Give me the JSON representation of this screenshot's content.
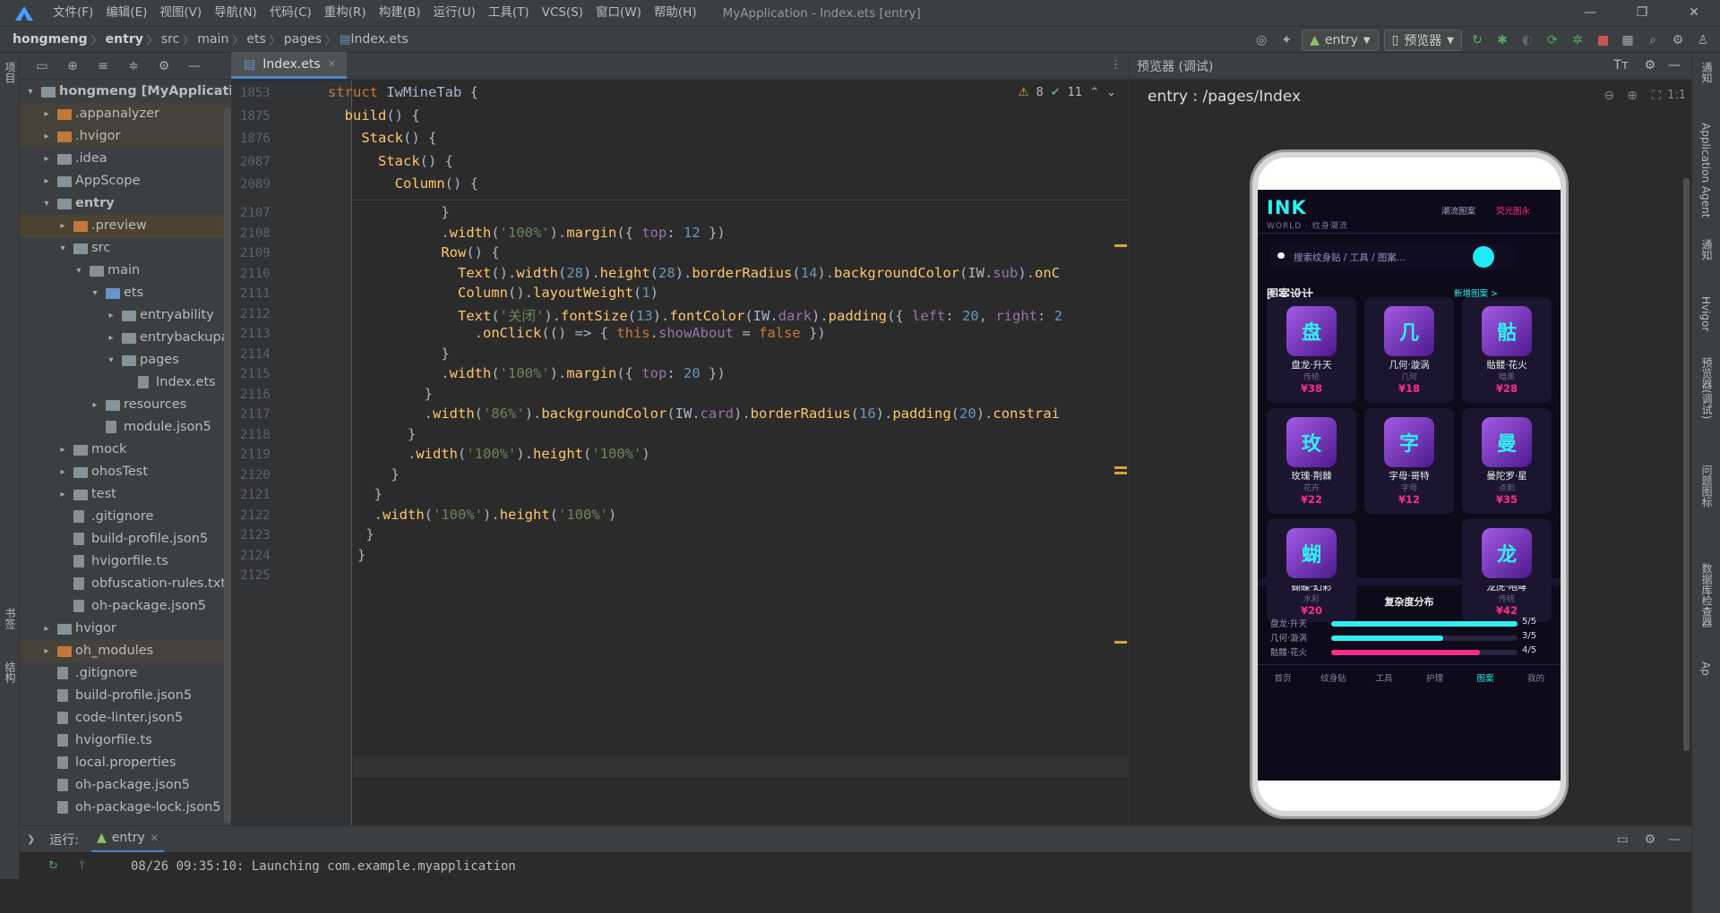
{
  "titlebar": {
    "menu": [
      "文件(F)",
      "编辑(E)",
      "视图(V)",
      "导航(N)",
      "代码(C)",
      "重构(R)",
      "构建(B)",
      "运行(U)",
      "工具(T)",
      "VCS(S)",
      "窗口(W)",
      "帮助(H)"
    ],
    "window_title": "MyApplication - Index.ets [entry]",
    "min": "—",
    "max": "❐",
    "close": "✕"
  },
  "breadcrumb": [
    "hongmeng",
    "entry",
    "src",
    "main",
    "ets",
    "pages",
    "Index.ets"
  ],
  "toolbar": {
    "run_config": "entry",
    "device": "预览器"
  },
  "left_strip": {
    "project": "项目",
    "bookmarks": "书签",
    "structure": "结构"
  },
  "project_tree": [
    {
      "indent": 0,
      "arrow": "▾",
      "kind": "fold",
      "label": "hongmeng [MyApplication]",
      "bold": true
    },
    {
      "indent": 1,
      "arrow": "▸",
      "kind": "fold org",
      "label": ".appanalyzer",
      "hl": true
    },
    {
      "indent": 1,
      "arrow": "▸",
      "kind": "fold org",
      "label": ".hvigor",
      "hl": true
    },
    {
      "indent": 1,
      "arrow": "▸",
      "kind": "fold",
      "label": ".idea"
    },
    {
      "indent": 1,
      "arrow": "▸",
      "kind": "fold",
      "label": "AppScope"
    },
    {
      "indent": 1,
      "arrow": "▾",
      "kind": "fold",
      "label": "entry",
      "bold": true
    },
    {
      "indent": 2,
      "arrow": "▸",
      "kind": "fold org",
      "label": ".preview",
      "sel": true
    },
    {
      "indent": 2,
      "arrow": "▾",
      "kind": "fold",
      "label": "src"
    },
    {
      "indent": 3,
      "arrow": "▾",
      "kind": "fold",
      "label": "main"
    },
    {
      "indent": 4,
      "arrow": "▾",
      "kind": "fold blu",
      "label": "ets"
    },
    {
      "indent": 5,
      "arrow": "▸",
      "kind": "fold",
      "label": "entryability"
    },
    {
      "indent": 5,
      "arrow": "▸",
      "kind": "fold",
      "label": "entrybackupability"
    },
    {
      "indent": 5,
      "arrow": "▾",
      "kind": "fold",
      "label": "pages"
    },
    {
      "indent": 6,
      "arrow": "",
      "kind": "file",
      "label": "Index.ets"
    },
    {
      "indent": 4,
      "arrow": "▸",
      "kind": "fold",
      "label": "resources"
    },
    {
      "indent": 4,
      "arrow": "",
      "kind": "file",
      "label": "module.json5"
    },
    {
      "indent": 2,
      "arrow": "▸",
      "kind": "fold",
      "label": "mock"
    },
    {
      "indent": 2,
      "arrow": "▸",
      "kind": "fold",
      "label": "ohosTest"
    },
    {
      "indent": 2,
      "arrow": "▸",
      "kind": "fold",
      "label": "test"
    },
    {
      "indent": 2,
      "arrow": "",
      "kind": "file",
      "label": ".gitignore"
    },
    {
      "indent": 2,
      "arrow": "",
      "kind": "file",
      "label": "build-profile.json5"
    },
    {
      "indent": 2,
      "arrow": "",
      "kind": "file",
      "label": "hvigorfile.ts"
    },
    {
      "indent": 2,
      "arrow": "",
      "kind": "file",
      "label": "obfuscation-rules.txt"
    },
    {
      "indent": 2,
      "arrow": "",
      "kind": "file",
      "label": "oh-package.json5"
    },
    {
      "indent": 1,
      "arrow": "▸",
      "kind": "fold",
      "label": "hvigor"
    },
    {
      "indent": 1,
      "arrow": "▸",
      "kind": "fold org",
      "label": "oh_modules",
      "hl": true
    },
    {
      "indent": 1,
      "arrow": "",
      "kind": "file",
      "label": ".gitignore"
    },
    {
      "indent": 1,
      "arrow": "",
      "kind": "file",
      "label": "build-profile.json5"
    },
    {
      "indent": 1,
      "arrow": "",
      "kind": "file",
      "label": "code-linter.json5"
    },
    {
      "indent": 1,
      "arrow": "",
      "kind": "file",
      "label": "hvigorfile.ts"
    },
    {
      "indent": 1,
      "arrow": "",
      "kind": "file",
      "label": "local.properties"
    },
    {
      "indent": 1,
      "arrow": "",
      "kind": "file",
      "label": "oh-package.json5"
    },
    {
      "indent": 1,
      "arrow": "",
      "kind": "file",
      "label": "oh-package-lock.json5"
    }
  ],
  "editor": {
    "tab": "Index.ets",
    "warnings": "8",
    "checks": "11",
    "sticky_lines": [
      {
        "n": "1853",
        "html": "<span class='kw'>struct</span> <span class='ty'>IwMineTab</span> {"
      },
      {
        "n": "1875",
        "html": "  <span class='fn'>build</span>() {"
      },
      {
        "n": "1876",
        "html": "    <span class='fn'>Stack</span>() {"
      },
      {
        "n": "2087",
        "html": "      <span class='fn'>Stack</span>() {"
      },
      {
        "n": "2089",
        "html": "        <span class='fn'>Column</span>() {"
      }
    ],
    "lines": [
      {
        "n": "2107",
        "html": "          }"
      },
      {
        "n": "2108",
        "html": "          .<span class='fn'>width</span>(<span class='st'>'100%'</span>).<span class='fn'>margin</span>({ <span class='pr'>top</span>: <span class='nu'>12</span> })"
      },
      {
        "n": "2109",
        "html": "          <span class='fn'>Row</span>() {"
      },
      {
        "n": "2110",
        "html": "            <span class='fn'>Text</span>().<span class='fn'>width</span>(<span class='nu'>28</span>).<span class='fn'>height</span>(<span class='nu'>28</span>).<span class='fn'>borderRadius</span>(<span class='nu'>14</span>).<span class='fn'>backgroundColor</span>(IW.<span class='pr'>sub</span>).<span class='fn'>onC</span>"
      },
      {
        "n": "2111",
        "html": "            <span class='fn'>Column</span>().<span class='fn'>layoutWeight</span>(<span class='nu'>1</span>)"
      },
      {
        "n": "2112",
        "html": "            <span class='fn'>Text</span>(<span class='st'>'关闭'</span>).<span class='fn'>fontSize</span>(<span class='nu'>13</span>).<span class='fn'>fontColor</span>(IW.<span class='pr'>dark</span>).<span class='fn'>padding</span>({ <span class='pr'>left</span>: <span class='nu'>20</span>, <span class='pr'>right</span>: <span class='nu'>2</span>"
      },
      {
        "n": "2113",
        "html": "              .<span class='fn'>onClick</span>(() => { <span class='kw'>this</span>.<span class='pr'>showAbout</span> = <span class='kw'>false</span> })"
      },
      {
        "n": "2114",
        "html": "          }"
      },
      {
        "n": "2115",
        "html": "          .<span class='fn'>width</span>(<span class='st'>'100%'</span>).<span class='fn'>margin</span>({ <span class='pr'>top</span>: <span class='nu'>20</span> })"
      },
      {
        "n": "2116",
        "html": "        }"
      },
      {
        "n": "2117",
        "html": "        .<span class='fn'>width</span>(<span class='st'>'86%'</span>).<span class='fn'>backgroundColor</span>(IW.<span class='pr'>card</span>).<span class='fn'>borderRadius</span>(<span class='nu'>16</span>).<span class='fn'>padding</span>(<span class='nu'>20</span>).<span class='fn'>constrai</span>"
      },
      {
        "n": "2118",
        "html": "      }"
      },
      {
        "n": "2119",
        "html": "      .<span class='fn'>width</span>(<span class='st'>'100%'</span>).<span class='fn'>height</span>(<span class='st'>'100%'</span>)"
      },
      {
        "n": "2120",
        "html": "    }"
      },
      {
        "n": "2121",
        "html": "  }"
      },
      {
        "n": "2122",
        "html": "  .<span class='fn'>width</span>(<span class='st'>'100%'</span>).<span class='fn'>height</span>(<span class='st'>'100%'</span>)"
      },
      {
        "n": "2123",
        "html": " }"
      },
      {
        "n": "2124",
        "html": "}"
      },
      {
        "n": "2125",
        "html": ""
      }
    ]
  },
  "preview": {
    "title": "预览器 (调试)",
    "route": "entry : /pages/Index",
    "zoom_label": "1:1"
  },
  "app": {
    "logo": "INK",
    "logo_sub": "WORLD · 纹身潮流",
    "top_link1": "潮流图案",
    "top_link2": "荧光图永",
    "search_placeholder": "搜索纹身贴 / 工具 / 图案...",
    "section_title": "图案设计",
    "section_action": "新增图案 >",
    "cards": [
      {
        "glyph": "盘",
        "name": "盘龙·升天",
        "sub": "传统",
        "price": "¥38"
      },
      {
        "glyph": "几",
        "name": "几何·漩涡",
        "sub": "几何",
        "price": "¥18"
      },
      {
        "glyph": "骷",
        "name": "骷髅·花火",
        "sub": "暗黑",
        "price": "¥28"
      },
      {
        "glyph": "玫",
        "name": "玫瑰·荆棘",
        "sub": "花卉",
        "price": "¥22"
      },
      {
        "glyph": "字",
        "name": "字母·哥特",
        "sub": "字母",
        "price": "¥12"
      },
      {
        "glyph": "曼",
        "name": "曼陀罗·星",
        "sub": "点刺",
        "price": "¥35"
      },
      {
        "glyph": "蝴",
        "name": "蝴蝶·幻彩",
        "sub": "水彩",
        "price": "¥20"
      },
      {
        "glyph": "龙",
        "name": "龙虎·咆哮",
        "sub": "传统",
        "price": "¥42"
      }
    ],
    "dist_title": "复杂度分布",
    "dist": [
      {
        "label": "盘龙·升天",
        "value": "5/5",
        "frac": 1.0,
        "color": "#2ef0f0"
      },
      {
        "label": "几何·漩涡",
        "value": "3/5",
        "frac": 0.6,
        "color": "#2ef0f0"
      },
      {
        "label": "骷髅·花火",
        "value": "4/5",
        "frac": 0.8,
        "color": "#ff2d8a"
      }
    ],
    "nav": [
      "首页",
      "纹身贴",
      "工具",
      "护理",
      "图案",
      "我的"
    ],
    "nav_active": 4
  },
  "right_strip": [
    "通知",
    "Application Agent",
    "通知",
    "Hvigor",
    "预览器(调试)",
    "问题图标",
    "数据库检查器",
    "Ap"
  ],
  "run": {
    "label": "运行:",
    "config": "entry",
    "console": "08/26 09:35:10: Launching com.example.myapplication"
  }
}
